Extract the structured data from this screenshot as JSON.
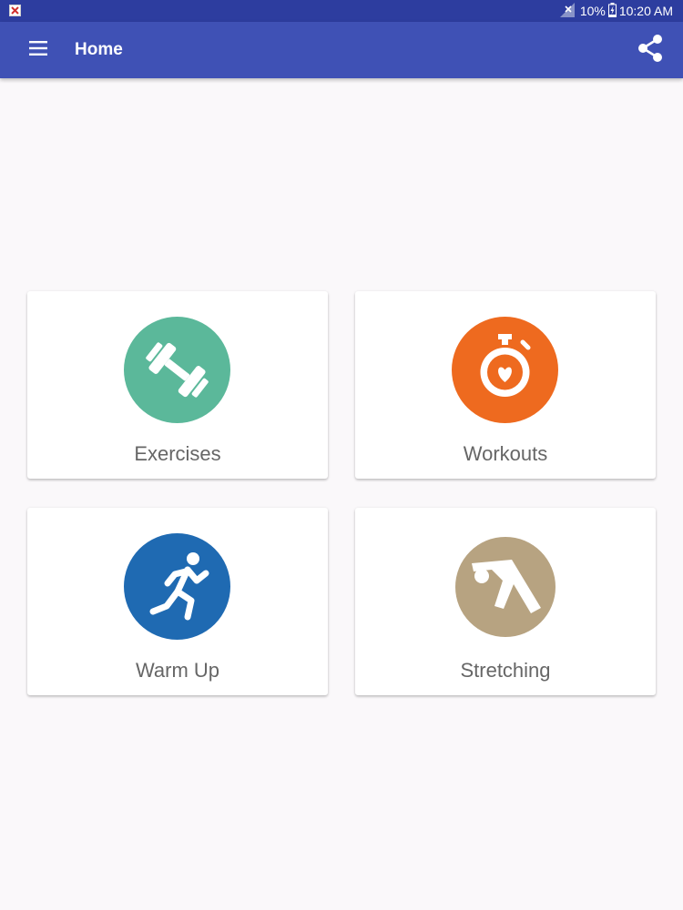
{
  "status_bar": {
    "battery": "10%",
    "time": "10:20 AM",
    "notif_icon": "notification-error-icon",
    "signal_icon": "signal-off-icon",
    "battery_icon": "battery-charging-icon"
  },
  "app_bar": {
    "title": "Home",
    "menu_icon": "hamburger-menu-icon",
    "share_icon": "share-icon"
  },
  "tiles": [
    {
      "label": "Exercises",
      "icon": "dumbbell-icon",
      "color": "#5bb89a"
    },
    {
      "label": "Workouts",
      "icon": "stopwatch-heart-icon",
      "color": "#ee6a1f"
    },
    {
      "label": "Warm Up",
      "icon": "running-person-icon",
      "color": "#1f6ab2"
    },
    {
      "label": "Stretching",
      "icon": "stretching-person-icon",
      "color": "#b7a381"
    }
  ],
  "colors": {
    "app_bar": "#3f51b5",
    "status_bar": "#2d3d9f",
    "background": "#faf8fa"
  }
}
